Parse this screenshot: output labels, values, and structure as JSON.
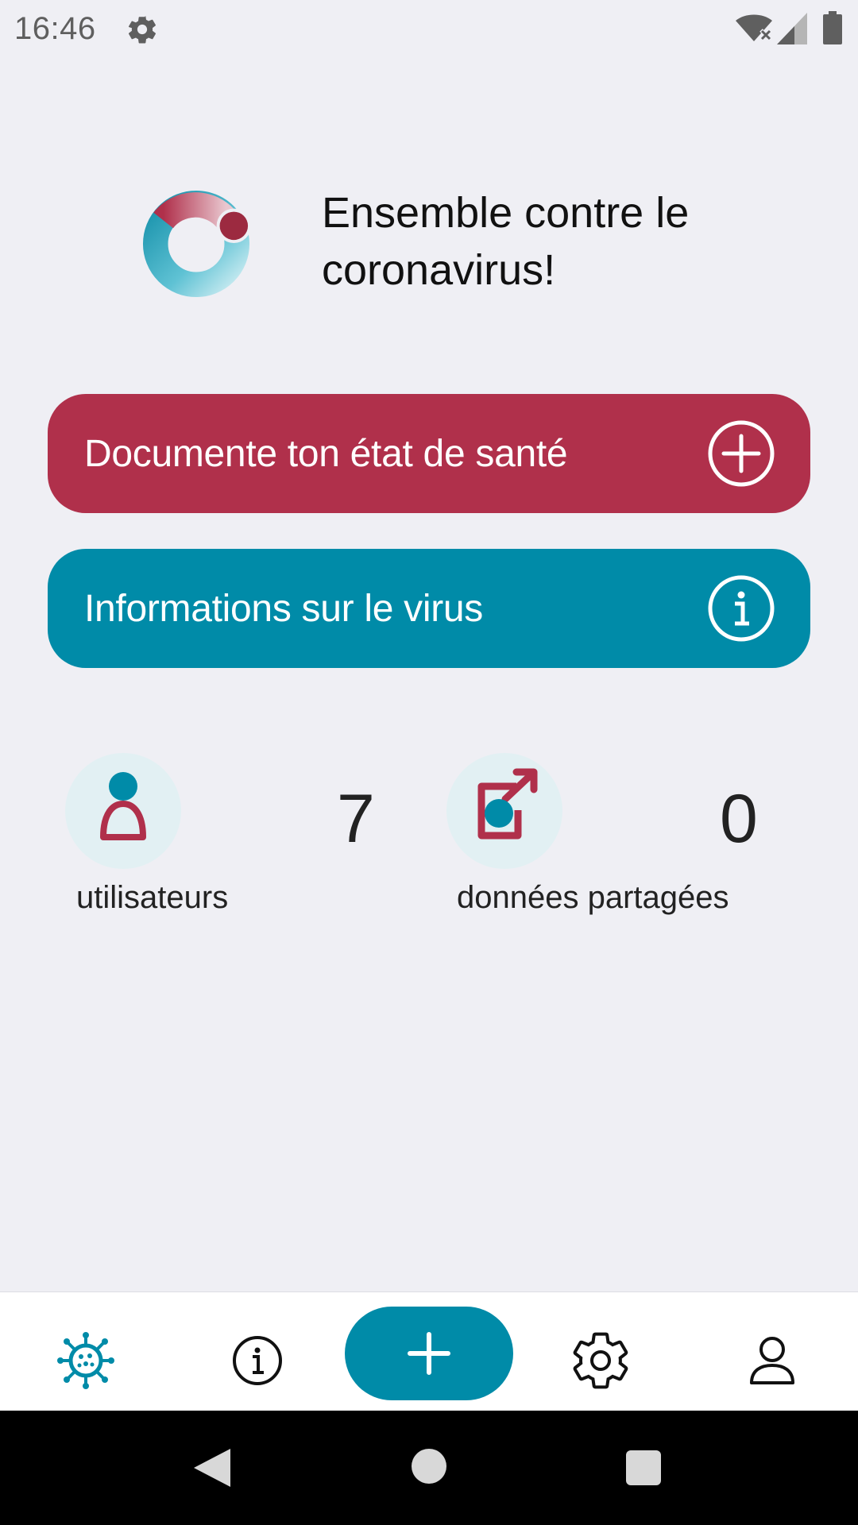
{
  "status_bar": {
    "time": "16:46",
    "icons": [
      "gear-icon",
      "wifi-off-icon",
      "signal-icon",
      "battery-icon"
    ]
  },
  "header": {
    "headline": "Ensemble contre le coronavirus!"
  },
  "actions": {
    "document_health": {
      "label": "Documente ton état de santé",
      "icon": "plus-circle-icon"
    },
    "virus_info": {
      "label": "Informations sur le virus",
      "icon": "info-circle-icon"
    }
  },
  "stats": {
    "users": {
      "value": "7",
      "label": "utilisateurs",
      "icon": "user-icon"
    },
    "shared": {
      "value": "0",
      "label": "données partagées",
      "icon": "share-icon"
    }
  },
  "bottom_nav": {
    "items": [
      "virus-icon",
      "info-icon",
      "plus-icon",
      "settings-icon",
      "profile-icon"
    ]
  },
  "colors": {
    "red": "#b0304b",
    "blue": "#008ba8",
    "background": "#efeff4",
    "stat_circle": "#e2f0f3"
  }
}
